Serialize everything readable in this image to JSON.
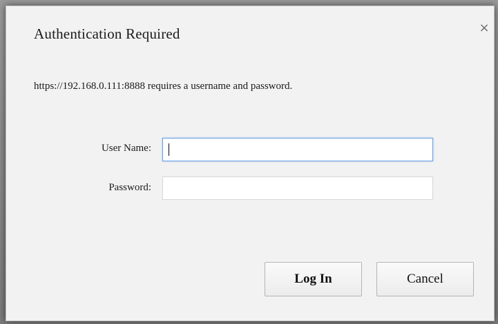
{
  "dialog": {
    "title": "Authentication Required",
    "close_glyph": "×",
    "close_icon": "close-icon",
    "message": "https://192.168.0.111:8888 requires a username and password."
  },
  "form": {
    "username_label": "User Name:",
    "username_value": "",
    "password_label": "Password:",
    "password_value": ""
  },
  "buttons": {
    "login_label": "Log In",
    "cancel_label": "Cancel"
  },
  "colors": {
    "focus_border": "#6aa1e3",
    "dialog_bg": "#f2f2f2"
  }
}
